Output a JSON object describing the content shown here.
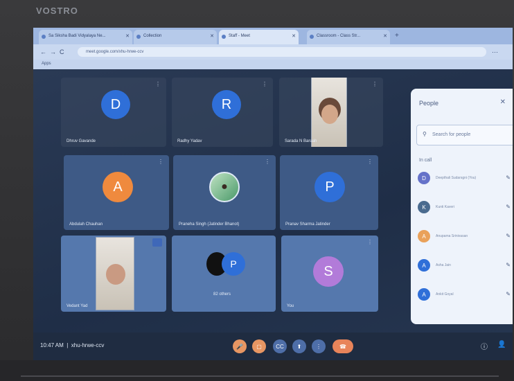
{
  "monitor": {
    "brand": "VOSTRO"
  },
  "browser": {
    "tabs": [
      {
        "label": "Sa Siksha Badi Vidyalaya Ne...",
        "active": false
      },
      {
        "label": "Collection",
        "active": false
      },
      {
        "label": "Staff - Meet",
        "active": true
      },
      {
        "label": "Classroom - Class Str...",
        "active": false
      }
    ],
    "url": "meet.google.com/xhu-hrwe-ccv",
    "bookmark": "Apps"
  },
  "tiles": [
    {
      "kind": "avatar",
      "letter": "D",
      "color": "#2f6fd8",
      "name": "Dhruv Gavande"
    },
    {
      "kind": "avatar",
      "letter": "R",
      "color": "#2f6fd8",
      "name": "Radhy Yadav"
    },
    {
      "kind": "video",
      "name": "Sarada N Baruah"
    },
    {
      "kind": "avatar",
      "letter": "A",
      "color": "#ef8a3e",
      "name": "Abdulah Chauhan"
    },
    {
      "kind": "photo",
      "name": "Praneha Singh (Jatinder Bhanot)"
    },
    {
      "kind": "avatar",
      "letter": "P",
      "color": "#2f6fd8",
      "name": "Pranav Sharma Jatinder"
    },
    {
      "kind": "video",
      "name": "Vedant Yad"
    },
    {
      "kind": "avatar2",
      "letter": "P",
      "color": "#2f6fd8",
      "name": "82 others"
    },
    {
      "kind": "avatar",
      "letter": "S",
      "color": "#b27bd9",
      "name": "You"
    }
  ],
  "people_panel": {
    "title": "People",
    "search_placeholder": "Search for people",
    "section": "In call",
    "rows": [
      {
        "letter": "D",
        "color": "#6572c9",
        "name": "Deepthali Sudarsgni (You)"
      },
      {
        "letter": "K",
        "color": "#4a6b8f",
        "name": "Kunti Kaveri"
      },
      {
        "letter": "A",
        "color": "#e9a15a",
        "name": "Anupama Srinivasan"
      },
      {
        "letter": "A",
        "color": "#2f6fd8",
        "name": "Asha Jain"
      },
      {
        "letter": "A",
        "color": "#2f6fd8",
        "name": "Ankit Goyal"
      }
    ]
  },
  "controls": {
    "time": "10:47 AM",
    "meeting_code": "xhu-hrwe-ccv",
    "buttons": [
      {
        "name": "mic-off-icon",
        "glyph": "🎤",
        "style": "orange"
      },
      {
        "name": "camera-off-icon",
        "glyph": "▢",
        "style": "orange"
      },
      {
        "name": "captions-icon",
        "glyph": "CC",
        "style": "blue"
      },
      {
        "name": "present-icon",
        "glyph": "⬆",
        "style": "blue"
      },
      {
        "name": "more-options-icon",
        "glyph": "⋮",
        "style": "blue"
      },
      {
        "name": "end-call-icon",
        "glyph": "☎",
        "style": "endcall"
      }
    ],
    "right_icons": [
      {
        "name": "info-icon",
        "glyph": "ⓘ"
      },
      {
        "name": "people-icon",
        "glyph": "👤"
      }
    ]
  }
}
